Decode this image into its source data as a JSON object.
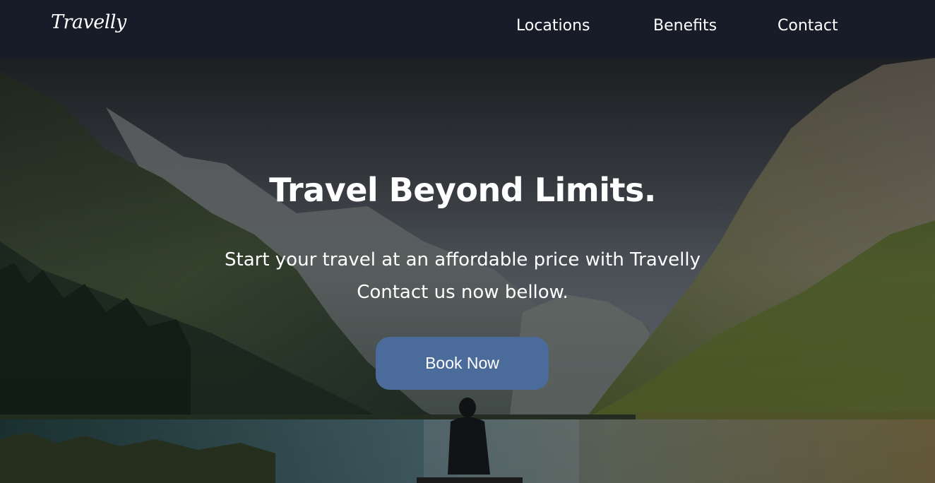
{
  "brand": {
    "logo_text": "Travelly"
  },
  "nav": {
    "items": [
      {
        "label": "Locations"
      },
      {
        "label": "Benefits"
      },
      {
        "label": "Contact"
      }
    ]
  },
  "hero": {
    "title": "Travel Beyond Limits.",
    "subtitle_line1": "Start your travel at an affordable price with Travelly",
    "subtitle_line2": "Contact us now bellow.",
    "cta_label": "Book Now"
  },
  "colors": {
    "header_bg": "#171c28",
    "button_bg": "#4b6b9a",
    "text": "#ffffff"
  }
}
